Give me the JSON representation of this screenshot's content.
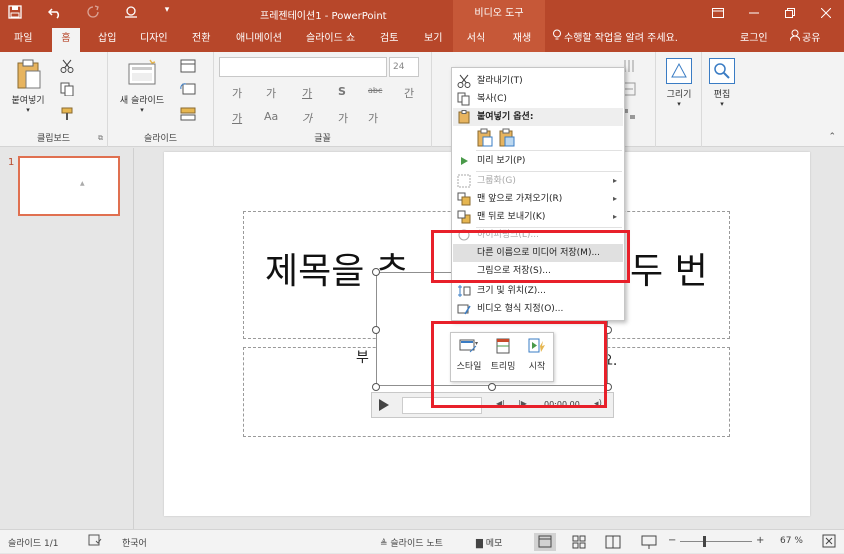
{
  "titlebar": {
    "doc_title": "프레젠테이션1 - PowerPoint",
    "context_tab": "비디오 도구",
    "qat_icons": [
      "save-icon",
      "undo-icon",
      "redo-icon",
      "customize-icon",
      "qat-more-icon"
    ],
    "win_icons": [
      "ribbon-display-icon",
      "minimize-icon",
      "restore-icon",
      "close-icon"
    ]
  },
  "tabs": {
    "file": "파일",
    "home": "홈",
    "insert": "삽입",
    "design": "디자인",
    "transitions": "전환",
    "animations": "애니메이션",
    "slideshow": "슬라이드 쇼",
    "review": "검토",
    "view": "보기",
    "format": "서식",
    "playback": "재생",
    "tellme": "수행할 작업을 알려 주세요.",
    "signin": "로그인",
    "share": "공유"
  },
  "ribbon": {
    "paste_label": "붙여넣기",
    "clipboard_label": "클립보드",
    "new_slide_label": "새 슬라이드",
    "slides_label": "슬라이드",
    "font_size": "24",
    "font_label": "글꼴",
    "draw_label": "그리기",
    "edit_label": "편집",
    "font_buttons": [
      "가",
      "가",
      "가",
      "S",
      "abc",
      "간"
    ],
    "font_buttons2": [
      "가",
      "Aa",
      "가",
      "가",
      "가"
    ]
  },
  "thumbnail": {
    "number": "1"
  },
  "slide": {
    "title_left": "제목을 추",
    "title_right": "두 번",
    "subtitle_left": "부",
    "subtitle_right": "요."
  },
  "mediabar": {
    "time": "00:00.00"
  },
  "minitoolbar": {
    "style": "스타일",
    "trim": "트리밍",
    "start": "시작"
  },
  "contextmenu": {
    "cut": "잘라내기(T)",
    "copy": "복사(C)",
    "paste_options": "붙여넣기 옵션:",
    "preview": "미리 보기(P)",
    "group": "그룹화(G)",
    "bring_front": "맨 앞으로 가져오기(R)",
    "send_back": "맨 뒤로 보내기(K)",
    "hyperlink": "하이퍼링크(L)...",
    "save_media": "다른 이름으로 미디어 저장(M)...",
    "save_picture": "그림으로 저장(S)...",
    "size_position": "크기 및 위치(Z)...",
    "format_video": "비디오 형식 지정(O)..."
  },
  "statusbar": {
    "slide_info": "슬라이드 1/1",
    "language": "한국어",
    "notes": "슬라이드 노트",
    "comments": "메모",
    "zoom": "67 %"
  },
  "colors": {
    "brand": "#b7472a",
    "highlight_box": "#e8202a"
  }
}
